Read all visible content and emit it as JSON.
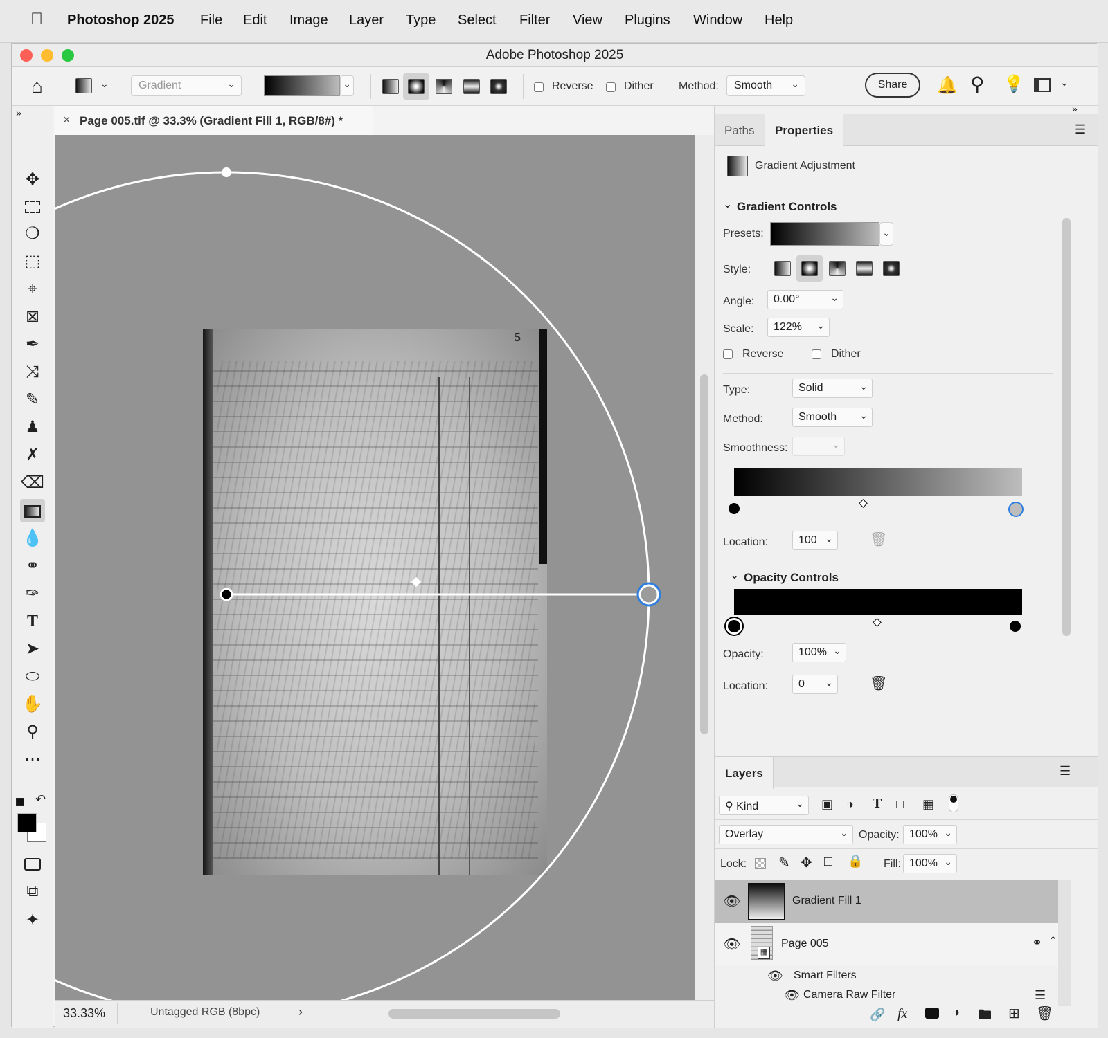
{
  "menubar": {
    "app_name": "Photoshop 2025",
    "items": [
      "File",
      "Edit",
      "Image",
      "Layer",
      "Type",
      "Select",
      "Filter",
      "View",
      "Plugins",
      "Window",
      "Help"
    ]
  },
  "window": {
    "title": "Adobe Photoshop 2025"
  },
  "options": {
    "tool_preset": "Gradient",
    "reverse_label": "Reverse",
    "reverse_checked": false,
    "dither_label": "Dither",
    "dither_checked": false,
    "method_label": "Method:",
    "method_value": "Smooth",
    "share_label": "Share"
  },
  "document": {
    "tab_title": "Page 005.tif @ 33.3% (Gradient Fill 1, RGB/8#) *",
    "page_number": "5",
    "zoom": "33.33%",
    "color_profile": "Untagged RGB (8bpc)"
  },
  "panel": {
    "tabs": [
      "Paths",
      "Properties"
    ],
    "active_tab": "Properties",
    "adjustment_title": "Gradient Adjustment",
    "gradient_controls": {
      "heading": "Gradient Controls",
      "presets_label": "Presets:",
      "style_label": "Style:",
      "angle_label": "Angle:",
      "angle_value": "0.00°",
      "scale_label": "Scale:",
      "scale_value": "122%",
      "reverse_label": "Reverse",
      "dither_label": "Dither",
      "type_label": "Type:",
      "type_value": "Solid",
      "method_label": "Method:",
      "method_value": "Smooth",
      "smoothness_label": "Smoothness:",
      "location_label": "Location:",
      "location_value": "100"
    },
    "opacity_controls": {
      "heading": "Opacity Controls",
      "opacity_label": "Opacity:",
      "opacity_value": "100%",
      "location_label": "Location:",
      "location_value": "0"
    }
  },
  "layers": {
    "tab_label": "Layers",
    "filter_kind": "Kind",
    "blend_mode": "Overlay",
    "opacity_label": "Opacity:",
    "opacity_value": "100%",
    "lock_label": "Lock:",
    "fill_label": "Fill:",
    "fill_value": "100%",
    "items": [
      {
        "name": "Gradient Fill 1",
        "selected": true
      },
      {
        "name": "Page 005",
        "selected": false
      },
      {
        "name": "Smart Filters",
        "selected": false
      },
      {
        "name": "Camera Raw Filter",
        "selected": false
      }
    ]
  },
  "colors": {
    "traffic_red": "#fe5f57",
    "traffic_yellow": "#febc2e",
    "traffic_green": "#28c840",
    "handle_blue": "#2f7fe0"
  }
}
